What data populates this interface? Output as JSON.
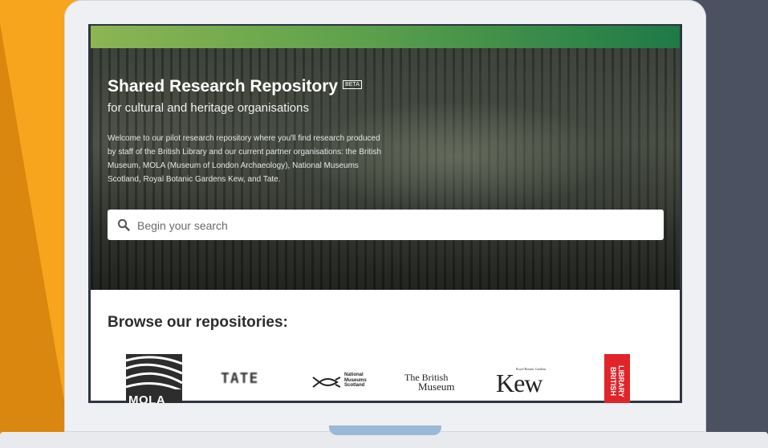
{
  "site": {
    "title": "Shared Research Repository",
    "badge": "BETA",
    "subtitle": "for cultural and heritage organisations",
    "description": "Welcome to our pilot research repository where you'll find research produced by staff of the British Library and our current partner organisations: the British Museum, MOLA (Museum of London Archaeology), National Museums Scotland, Royal Botanic Gardens Kew, and Tate."
  },
  "search": {
    "placeholder": "Begin your search",
    "value": ""
  },
  "browse": {
    "heading": "Browse our repositories:",
    "repositories": [
      {
        "name": "MOLA",
        "logo_text": "MOLA"
      },
      {
        "name": "Tate",
        "logo_text": "TATE"
      },
      {
        "name": "National Museums Scotland",
        "logo_text": [
          "National",
          "Museums",
          "Scotland"
        ]
      },
      {
        "name": "British Museum",
        "logo_text": [
          "The British",
          "Museum"
        ]
      },
      {
        "name": "Kew",
        "logo_text": "Kew",
        "logo_subtext": "Royal Botanic Gardens"
      },
      {
        "name": "British Library",
        "logo_text": [
          "BRITISH",
          "LIBRARY"
        ]
      }
    ]
  },
  "colors": {
    "background": "#4b5160",
    "accent_orange": "#f6a51c",
    "green_start": "#8db553",
    "green_end": "#1e7a47",
    "british_library_red": "#e0242a"
  }
}
